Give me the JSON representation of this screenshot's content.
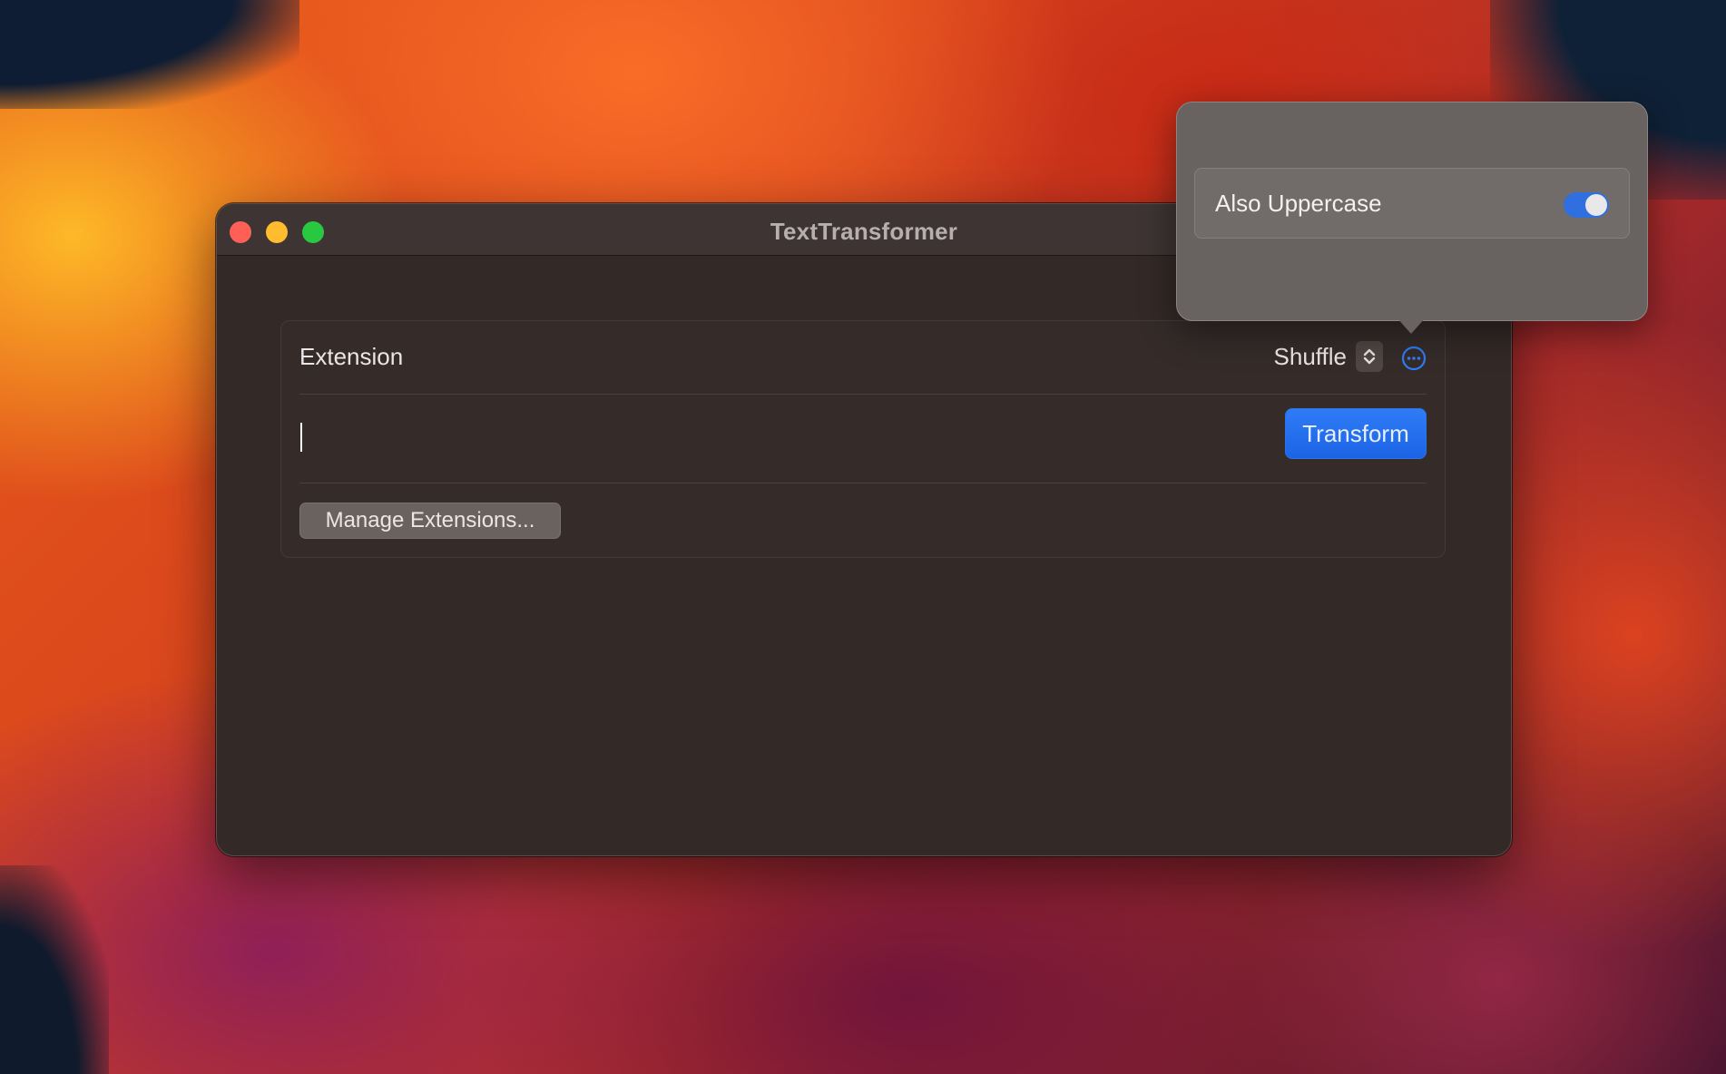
{
  "window": {
    "title": "TextTransformer"
  },
  "form": {
    "extension_label": "Extension",
    "extension_selected": "Shuffle",
    "input_value": "",
    "transform_label": "Transform",
    "manage_label": "Manage Extensions..."
  },
  "popover": {
    "toggle_label": "Also Uppercase",
    "toggle_on": true
  },
  "icons": {
    "more": "ellipsis-circle-icon",
    "stepper": "chevron-up-down-icon"
  },
  "colors": {
    "accent": "#1c64e6",
    "close": "#fe5f57",
    "minimize": "#febc2e",
    "maximize": "#28c840"
  }
}
